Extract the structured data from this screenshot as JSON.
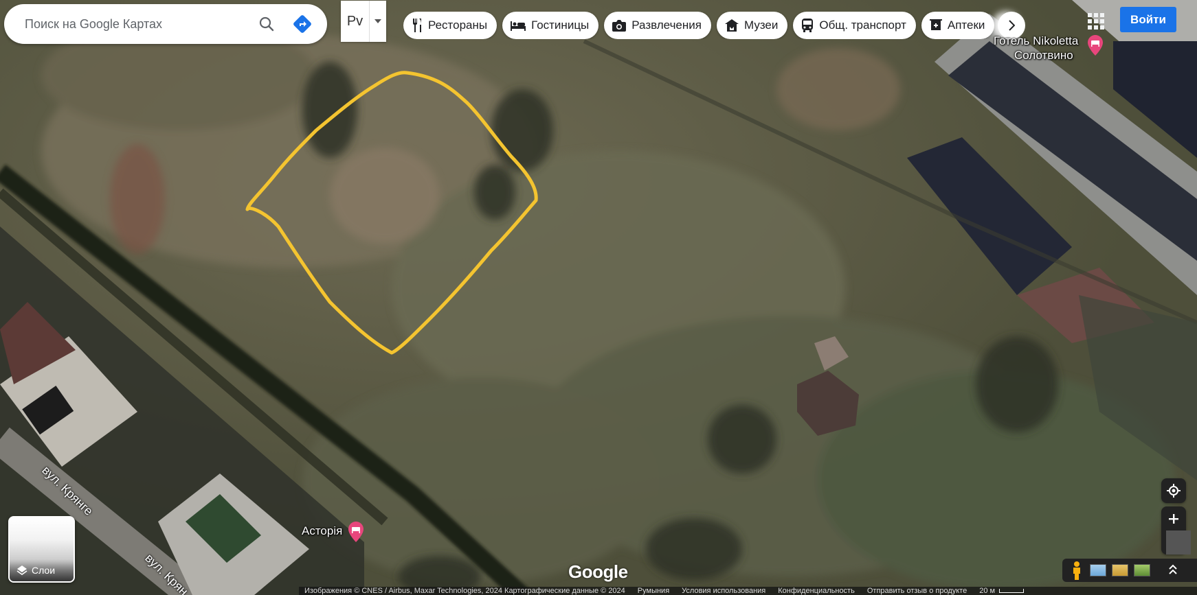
{
  "search": {
    "placeholder": "Поиск на Google Картах"
  },
  "map_mode": {
    "label": "Рv"
  },
  "chips": [
    {
      "label": "Рестораны",
      "icon": "fork-knife-icon"
    },
    {
      "label": "Гостиницы",
      "icon": "bed-icon"
    },
    {
      "label": "Развлечения",
      "icon": "camera-icon"
    },
    {
      "label": "Музеи",
      "icon": "museum-icon"
    },
    {
      "label": "Общ. транспорт",
      "icon": "bus-icon"
    },
    {
      "label": "Аптеки",
      "icon": "pharmacy-icon"
    }
  ],
  "header": {
    "signin_label": "Войти"
  },
  "places": {
    "hotel_name_line1": "Готель Nikoletta",
    "hotel_name_line2": "Солотвино",
    "asteria": "Асторія"
  },
  "streets": {
    "street_1": "вул. Крянге",
    "street_2": "вул. Крян"
  },
  "layers": {
    "label": "Слои"
  },
  "logo": "Google",
  "footer": {
    "imagery": "Изображения © CNES / Airbus, Maxar Technologies, 2024 Картографические данные © 2024",
    "country": "Румыния",
    "terms": "Условия использования",
    "privacy": "Конфиденциальность",
    "feedback": "Отправить отзыв о продукте",
    "scale": "20 м"
  },
  "colors": {
    "outline": "#f4c430",
    "signin_bg": "#1a73e8",
    "poi_pin": "#e8467c"
  }
}
